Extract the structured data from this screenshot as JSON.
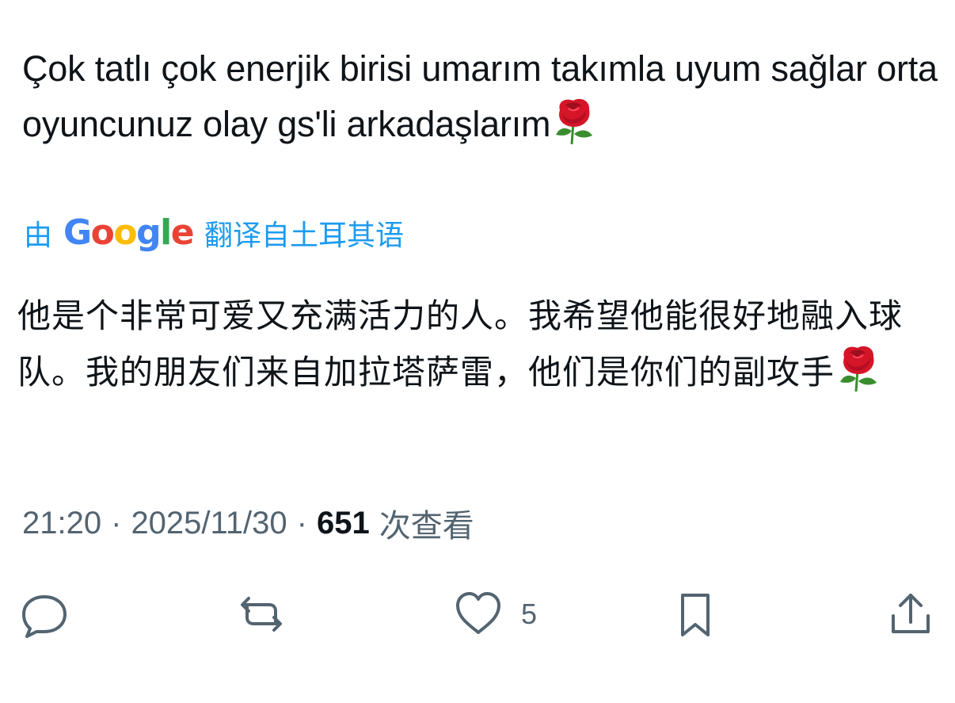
{
  "tweet": {
    "original_text": "Çok tatlı çok enerjik birisi umarım takımla uyum sağlar orta oyuncunuz olay gs'li arkadaşlarım",
    "translation": {
      "prefix": "由",
      "provider": "Google",
      "suffix": "翻译自土耳其语"
    },
    "translated_text": "他是个非常可爱又充满活力的人。我希望他能很好地融入球队。我的朋友们来自加拉塔萨雷，他们是你们的副攻手",
    "emoji": "rose-icon",
    "meta": {
      "time": "21:20",
      "separator": "·",
      "date": "2025/11/30",
      "views": "651",
      "views_label": "次查看"
    },
    "actions": {
      "likes_count": "5"
    }
  },
  "colors": {
    "text": "#0f1419",
    "secondary": "#536471",
    "accent": "#1d9bf0",
    "rose_red": "#d51528",
    "rose_green": "#3a8d2f"
  }
}
